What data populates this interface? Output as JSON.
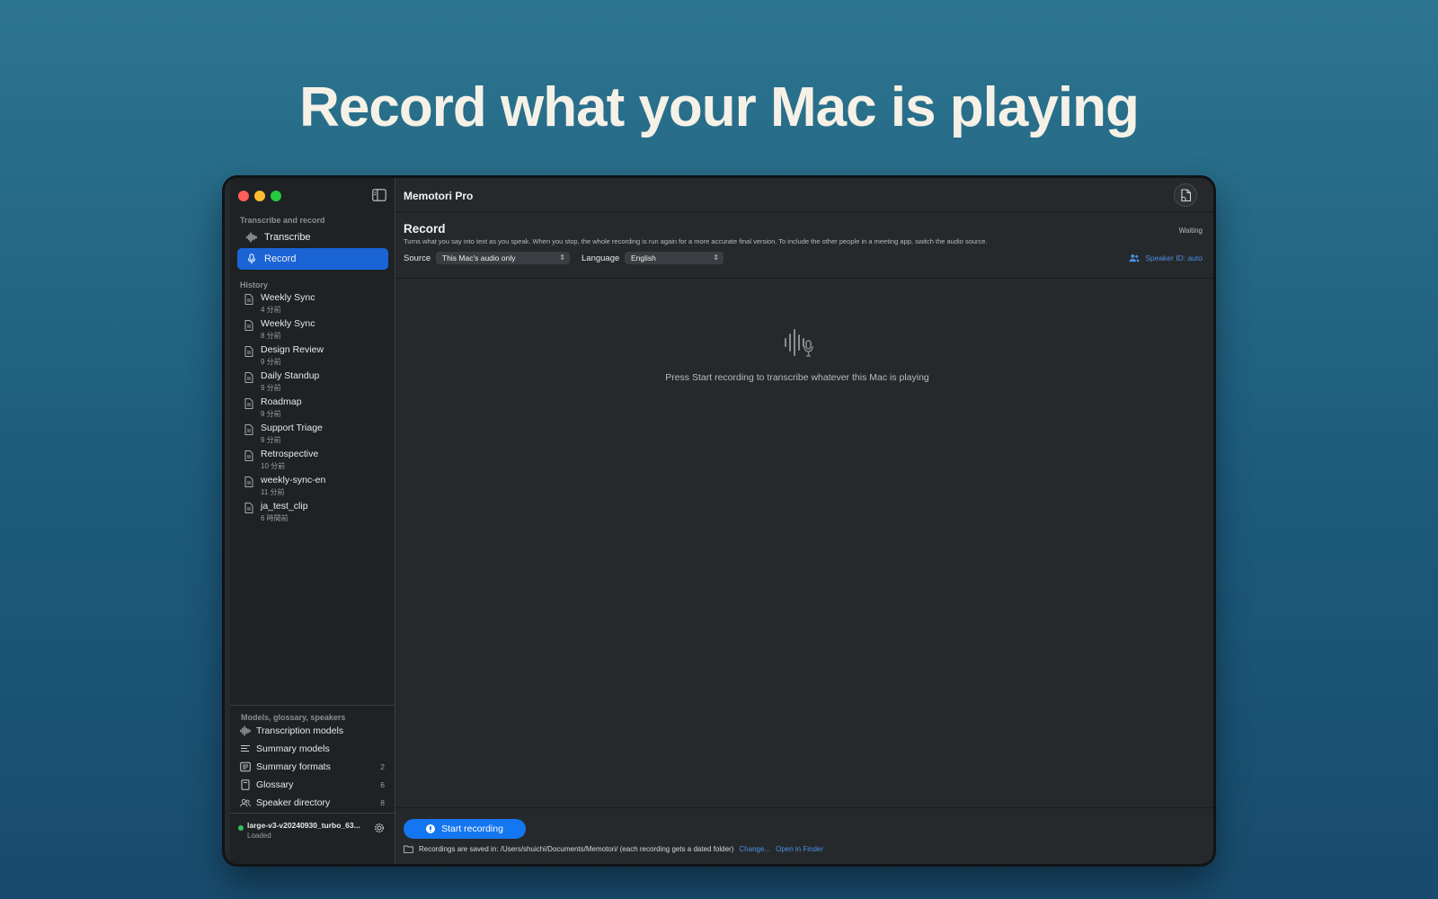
{
  "headline": "Record what your Mac is playing",
  "sidebar": {
    "section_transcribe": "Transcribe and record",
    "nav": [
      {
        "label": "Transcribe",
        "icon": "waveform-icon"
      },
      {
        "label": "Record",
        "icon": "microphone-icon",
        "active": true
      }
    ],
    "section_history": "History",
    "history": [
      {
        "title": "Weekly Sync",
        "time": "4 分前"
      },
      {
        "title": "Weekly Sync",
        "time": "8 分前"
      },
      {
        "title": "Design Review",
        "time": "9 分前"
      },
      {
        "title": "Daily Standup",
        "time": "9 分前"
      },
      {
        "title": "Roadmap",
        "time": "9 分前"
      },
      {
        "title": "Support Triage",
        "time": "9 分前"
      },
      {
        "title": "Retrospective",
        "time": "10 分前"
      },
      {
        "title": "weekly-sync-en",
        "time": "11 分前"
      },
      {
        "title": "ja_test_clip",
        "time": "6 時間前"
      }
    ],
    "section_models": "Models, glossary, speakers",
    "bottom_items": [
      {
        "label": "Transcription models",
        "count": ""
      },
      {
        "label": "Summary models",
        "count": ""
      },
      {
        "label": "Summary formats",
        "count": "2"
      },
      {
        "label": "Glossary",
        "count": "6"
      },
      {
        "label": "Speaker directory",
        "count": "8"
      }
    ],
    "model": {
      "name": "large-v3-v20240930_turbo_63...",
      "status": "Loaded"
    }
  },
  "main": {
    "app_title": "Memotori Pro",
    "record_title": "Record",
    "status": "Waiting",
    "description": "Turns what you say into text as you speak. When you stop, the whole recording is run again for a more accurate final version. To include the other people in a meeting app, switch the audio source.",
    "source_label": "Source",
    "source_value": "This Mac's audio only",
    "language_label": "Language",
    "language_value": "English",
    "speaker_id": "Speaker ID: auto",
    "empty_text": "Press Start recording to transcribe whatever this Mac is playing",
    "start_button": "Start recording",
    "save_text": "Recordings are saved in: /Users/shuichi/Documents/Memotori/ (each recording gets a dated folder)",
    "change_link": "Change...",
    "open_finder_link": "Open in Finder"
  },
  "colors": {
    "accent": "#1a64d6",
    "button": "#1476f0",
    "link": "#4a90e2"
  }
}
